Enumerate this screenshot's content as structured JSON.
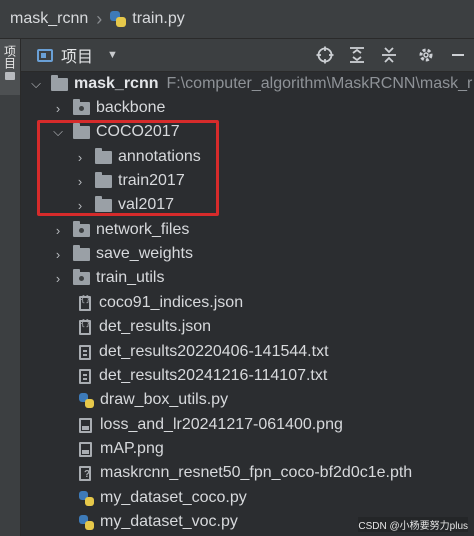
{
  "breadcrumb": {
    "project": "mask_rcnn",
    "file": "train.py"
  },
  "sidebar": {
    "tab_label": "项目"
  },
  "toolbar": {
    "view_label": "项目",
    "icons": [
      "locate-icon",
      "expand-all-icon",
      "collapse-all-icon",
      "gear-icon",
      "hide-icon"
    ]
  },
  "tree": {
    "root": {
      "name": "mask_rcnn",
      "path": "F:\\computer_algorithm\\MaskRCNN\\mask_r"
    },
    "items": [
      {
        "name": "backbone",
        "type": "package"
      },
      {
        "name": "COCO2017",
        "type": "folder",
        "expanded": true
      },
      {
        "name": "annotations",
        "type": "folder"
      },
      {
        "name": "train2017",
        "type": "folder"
      },
      {
        "name": "val2017",
        "type": "folder"
      },
      {
        "name": "network_files",
        "type": "package"
      },
      {
        "name": "save_weights",
        "type": "folder"
      },
      {
        "name": "train_utils",
        "type": "package"
      },
      {
        "name": "coco91_indices.json",
        "type": "json"
      },
      {
        "name": "det_results.json",
        "type": "json"
      },
      {
        "name": "det_results20220406-141544.txt",
        "type": "text"
      },
      {
        "name": "det_results20241216-114107.txt",
        "type": "text"
      },
      {
        "name": "draw_box_utils.py",
        "type": "python"
      },
      {
        "name": "loss_and_lr20241217-061400.png",
        "type": "image"
      },
      {
        "name": "mAP.png",
        "type": "image"
      },
      {
        "name": "maskrcnn_resnet50_fpn_coco-bf2d0c1e.pth",
        "type": "unknown"
      },
      {
        "name": "my_dataset_coco.py",
        "type": "python"
      },
      {
        "name": "my_dataset_voc.py",
        "type": "python"
      }
    ]
  },
  "watermark": "CSDN @小杨要努力plus",
  "colors": {
    "background": "#2b2d30",
    "highlight_box": "#d62b2b",
    "python_blue": "#3d7ab8",
    "python_yellow": "#e6c84a"
  }
}
